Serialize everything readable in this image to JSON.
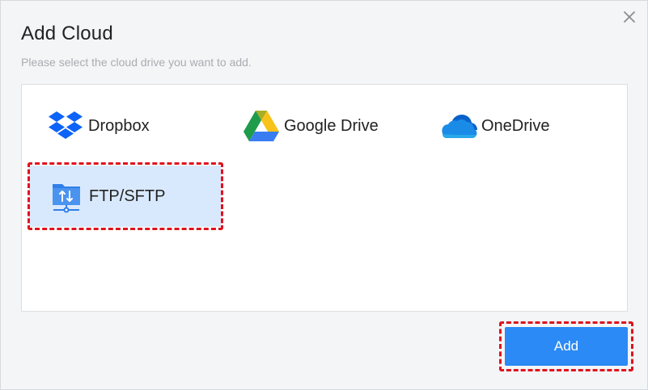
{
  "dialog": {
    "title": "Add Cloud",
    "subtitle": "Please select the cloud drive you want to add.",
    "close_icon": "close-icon"
  },
  "providers": [
    {
      "label": "Dropbox",
      "icon": "dropbox-icon",
      "selected": false
    },
    {
      "label": "Google Drive",
      "icon": "google-drive-icon",
      "selected": false
    },
    {
      "label": "OneDrive",
      "icon": "onedrive-icon",
      "selected": false
    },
    {
      "label": "FTP/SFTP",
      "icon": "ftp-sftp-icon",
      "selected": true
    }
  ],
  "footer": {
    "add_label": "Add"
  },
  "colors": {
    "accent": "#2b8af5",
    "selected_bg": "#d9e9fd",
    "highlight": "#e0121e"
  }
}
